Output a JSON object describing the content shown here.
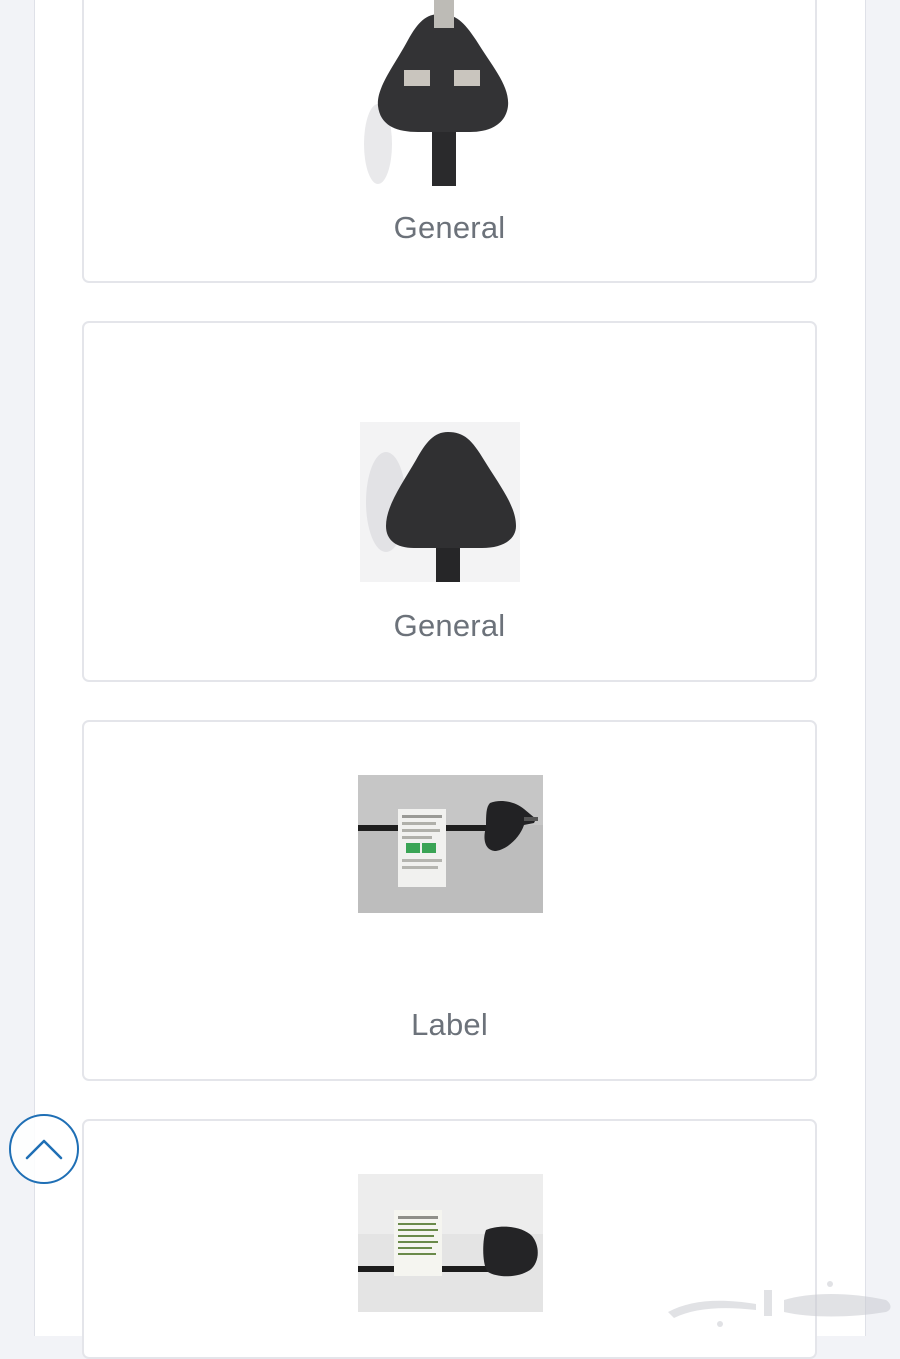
{
  "cards": [
    {
      "caption": "General",
      "image": "uk-plug-pins-photo"
    },
    {
      "caption": "General",
      "image": "uk-plug-back-photo"
    },
    {
      "caption": "Label",
      "image": "plug-cable-label-photo"
    },
    {
      "caption": "",
      "image": "plug-cable-label-closeup-photo"
    }
  ],
  "scroll_top": {
    "icon": "chevron-up-icon"
  },
  "watermark": {
    "name": "haraj-logo"
  },
  "colors": {
    "background": "#f2f3f7",
    "card_border": "#e4e5ea",
    "caption_text": "#6c727a",
    "accent": "#1f6fb5"
  }
}
